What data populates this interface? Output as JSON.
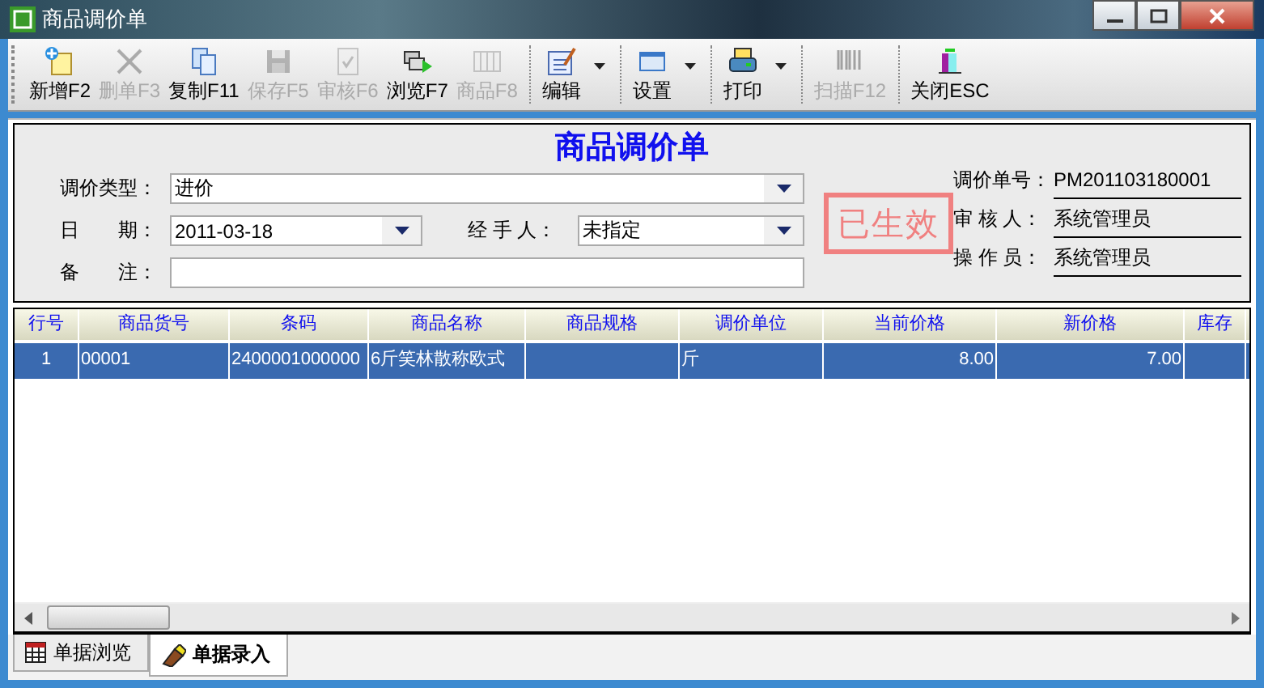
{
  "window": {
    "title": "商品调价单"
  },
  "toolbar": [
    {
      "kind": "button",
      "label": "新增F2",
      "disabled": false,
      "dropdown": false
    },
    {
      "kind": "button",
      "label": "删单F3",
      "disabled": true,
      "dropdown": false
    },
    {
      "kind": "button",
      "label": "复制F11",
      "disabled": false,
      "dropdown": false
    },
    {
      "kind": "button",
      "label": "保存F5",
      "disabled": true,
      "dropdown": false
    },
    {
      "kind": "button",
      "label": "审核F6",
      "disabled": true,
      "dropdown": false
    },
    {
      "kind": "button",
      "label": "浏览F7",
      "disabled": false,
      "dropdown": false
    },
    {
      "kind": "button",
      "label": "商品F8",
      "disabled": true,
      "dropdown": false
    },
    {
      "kind": "separator"
    },
    {
      "kind": "button",
      "label": "编辑",
      "disabled": false,
      "dropdown": true
    },
    {
      "kind": "separator"
    },
    {
      "kind": "button",
      "label": "设置",
      "disabled": false,
      "dropdown": true
    },
    {
      "kind": "separator"
    },
    {
      "kind": "button",
      "label": "打印",
      "disabled": false,
      "dropdown": true
    },
    {
      "kind": "separator"
    },
    {
      "kind": "button",
      "label": "扫描F12",
      "disabled": true,
      "dropdown": false
    },
    {
      "kind": "separator"
    },
    {
      "kind": "button",
      "label": "关闭ESC",
      "disabled": false,
      "dropdown": false
    }
  ],
  "form": {
    "title": "商品调价单",
    "price_type": {
      "label": "调价类型：",
      "value": "进价"
    },
    "date": {
      "label": "日　　期：",
      "value": "2011-03-18"
    },
    "handler": {
      "label": "经 手 人：",
      "value": "未指定"
    },
    "remark": {
      "label": "备　　注："
    },
    "info": [
      {
        "label": "调价单号：",
        "value": "PM201103180001"
      },
      {
        "label": "审 核 人：",
        "value": "系统管理员"
      },
      {
        "label": "操 作 员：",
        "value": "系统管理员"
      }
    ],
    "stamp": "已生效"
  },
  "table": {
    "columns": [
      "行号",
      "商品货号",
      "条码",
      "商品名称",
      "商品规格",
      "调价单位",
      "当前价格",
      "新价格",
      "库存"
    ],
    "rows": [
      {
        "selected": true,
        "cells": [
          "1",
          "00001",
          "2400001000000",
          "6斤笑林散称欧式",
          null,
          "斤",
          "8.00",
          "7.00",
          null
        ]
      }
    ]
  },
  "tabs": [
    {
      "label": "单据浏览",
      "selected": false
    },
    {
      "label": "单据录入",
      "selected": true
    }
  ]
}
